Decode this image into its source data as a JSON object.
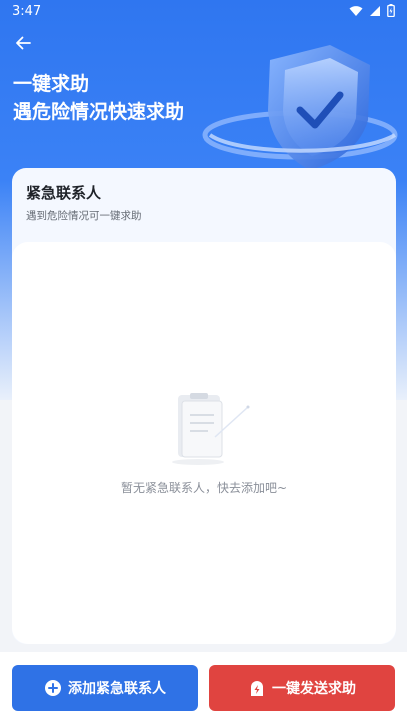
{
  "status_bar": {
    "time": "3:47"
  },
  "header": {
    "title_line1": "一键求助",
    "title_line2": "遇危险情况快速求助"
  },
  "card": {
    "title": "紧急联系人",
    "subtitle": "遇到危险情况可一键求助",
    "empty_text": "暂无紧急联系人，快去添加吧~"
  },
  "actions": {
    "add_contact_label": "添加紧急联系人",
    "sos_label": "一键发送求助"
  },
  "colors": {
    "primary": "#2f72e6",
    "danger": "#e04440",
    "header_blue": "#3b82f6"
  },
  "icons": [
    "arrow-back-icon",
    "wifi-icon",
    "signal-icon",
    "battery-icon",
    "shield-icon",
    "clipboard-icon",
    "plus-circle-icon",
    "alert-bolt-icon"
  ]
}
